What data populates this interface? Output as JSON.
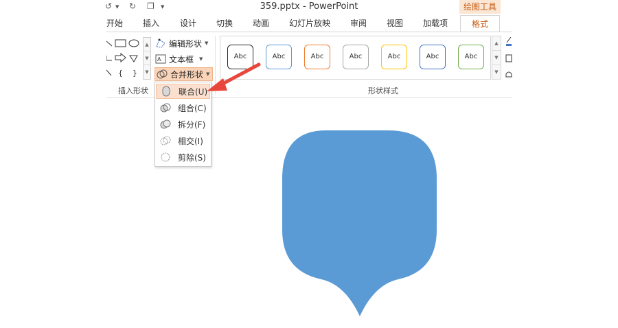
{
  "window": {
    "title": "359.pptx - PowerPoint",
    "context_tab": "绘图工具"
  },
  "tabs": [
    {
      "label": "开始"
    },
    {
      "label": "插入"
    },
    {
      "label": "设计"
    },
    {
      "label": "切换"
    },
    {
      "label": "动画"
    },
    {
      "label": "幻灯片放映"
    },
    {
      "label": "审阅"
    },
    {
      "label": "视图"
    },
    {
      "label": "加载项"
    },
    {
      "label": "格式",
      "active": true
    }
  ],
  "ribbon": {
    "insert_shapes": {
      "edit_shape": "编辑形状",
      "text_box": "文本框",
      "merge_shapes": "合并形状",
      "group_label": "插入形状"
    },
    "shape_styles": {
      "group_label": "形状样式",
      "styles": [
        {
          "label": "Abc",
          "color": "#262626"
        },
        {
          "label": "Abc",
          "color": "#5b9bd5"
        },
        {
          "label": "Abc",
          "color": "#ed7d31"
        },
        {
          "label": "Abc",
          "color": "#a5a5a5"
        },
        {
          "label": "Abc",
          "color": "#ffc000"
        },
        {
          "label": "Abc",
          "color": "#4472c4"
        },
        {
          "label": "Abc",
          "color": "#70ad47"
        }
      ]
    }
  },
  "merge_menu": {
    "items": [
      {
        "label": "联合(U)",
        "icon": "union-icon",
        "highlighted": true
      },
      {
        "label": "组合(C)",
        "icon": "combine-icon"
      },
      {
        "label": "拆分(F)",
        "icon": "fragment-icon"
      },
      {
        "label": "相交(I)",
        "icon": "intersect-icon"
      },
      {
        "label": "剪除(S)",
        "icon": "subtract-icon"
      }
    ]
  },
  "canvas": {
    "shape_color": "#5b9bd5"
  },
  "annotation": {
    "arrow_color": "#e8473b"
  }
}
